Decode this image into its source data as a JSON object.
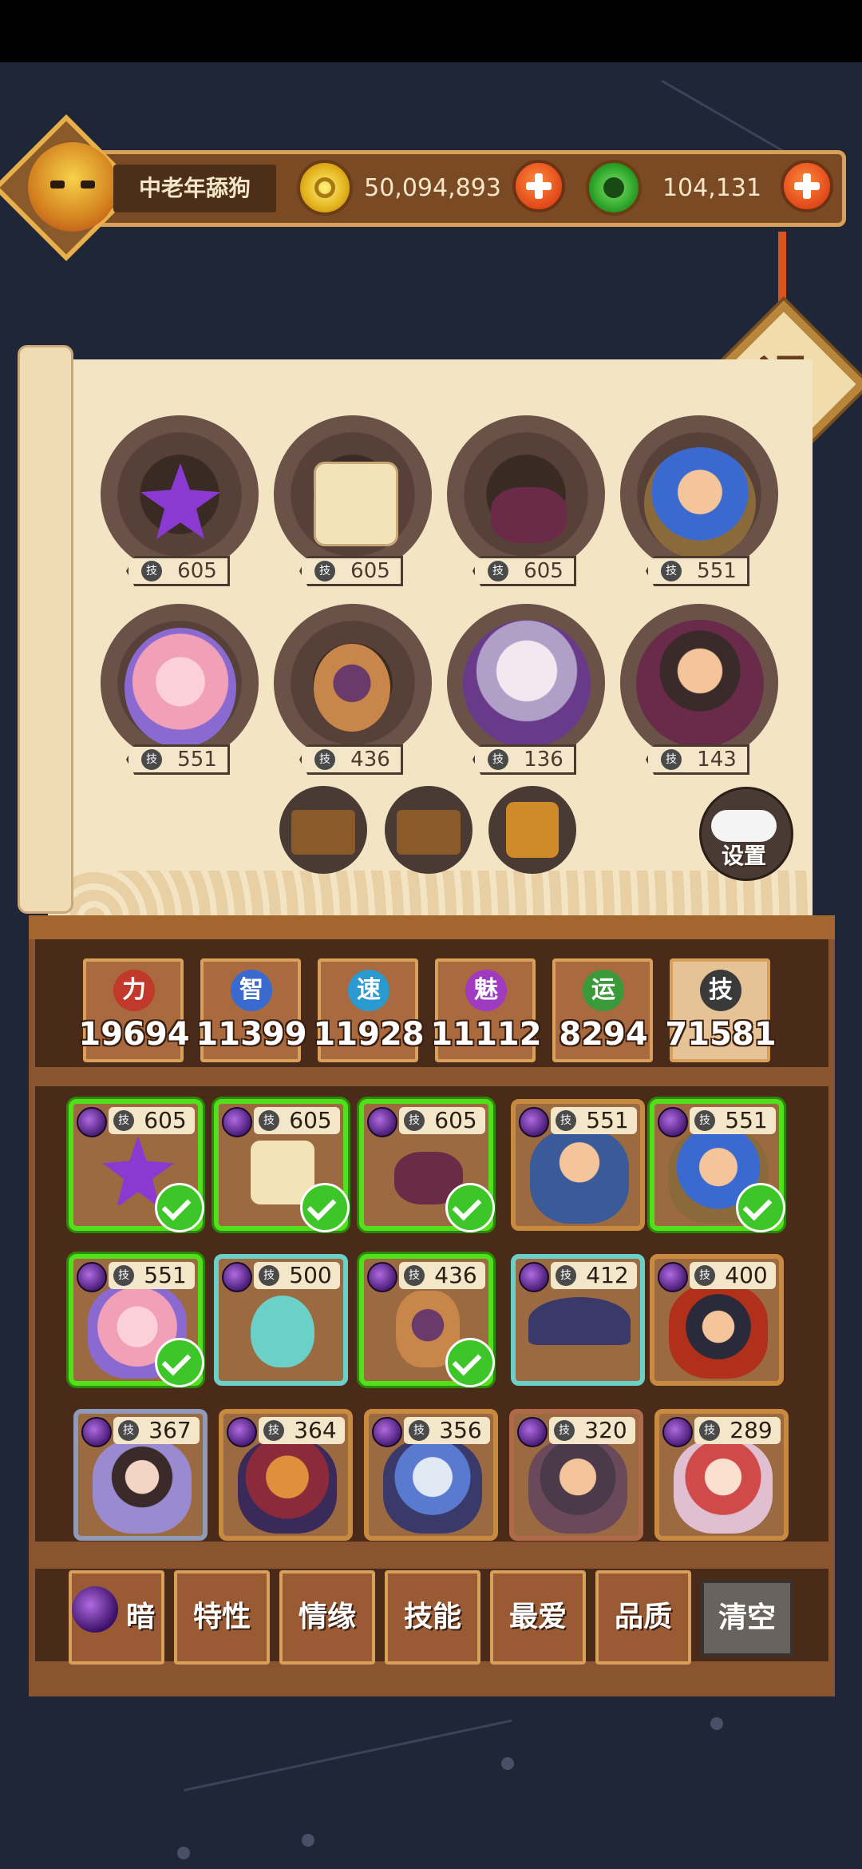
{
  "player": {
    "name": "中老年舔狗",
    "avatar_icon": "demon-mask-icon"
  },
  "currencies": {
    "gold": {
      "icon": "gold-coin-icon",
      "value": "50,094,893"
    },
    "jade": {
      "icon": "jade-coin-icon",
      "value": "104,131"
    }
  },
  "exit_label": "退",
  "team_slots": [
    {
      "name": "purple-star-hero",
      "skill": "605"
    },
    {
      "name": "tofu-hero",
      "skill": "605"
    },
    {
      "name": "pot-hero",
      "skill": "605"
    },
    {
      "name": "farmer-hero",
      "skill": "551"
    },
    {
      "name": "witch-girl-hero",
      "skill": "551"
    },
    {
      "name": "beetle-hero",
      "skill": "436"
    },
    {
      "name": "white-hair-hero",
      "skill": "136"
    },
    {
      "name": "sorcerer-hero",
      "skill": "143"
    }
  ],
  "skill_badge": "技",
  "food_items": [
    "food-box-1",
    "food-box-2",
    "mooncake-box"
  ],
  "settings_label": "设置",
  "stats": [
    {
      "label": "力",
      "value": "19694",
      "color": "#c0392b"
    },
    {
      "label": "智",
      "value": "11399",
      "color": "#3a6ad0"
    },
    {
      "label": "速",
      "value": "11928",
      "color": "#2a9ad0"
    },
    {
      "label": "魅",
      "value": "11112",
      "color": "#a03ac0"
    },
    {
      "label": "运",
      "value": "8294",
      "color": "#3a9a3a"
    },
    {
      "label": "技",
      "value": "71581",
      "color": "#3a3a3a"
    }
  ],
  "heroes": [
    {
      "name": "purple-star",
      "skill": "605",
      "selected": true
    },
    {
      "name": "tofu",
      "skill": "605",
      "selected": true
    },
    {
      "name": "pot",
      "skill": "605",
      "selected": true
    },
    {
      "name": "bearded-man",
      "skill": "551",
      "selected": false
    },
    {
      "name": "farmer",
      "skill": "551",
      "selected": true
    },
    {
      "name": "witch-girl",
      "skill": "551",
      "selected": true
    },
    {
      "name": "slime",
      "skill": "500",
      "selected": false
    },
    {
      "name": "beetle",
      "skill": "436",
      "selected": true
    },
    {
      "name": "straw-hat",
      "skill": "412",
      "selected": false
    },
    {
      "name": "general",
      "skill": "400",
      "selected": false
    },
    {
      "name": "snow-girl",
      "skill": "367",
      "selected": false
    },
    {
      "name": "pumpkin-king",
      "skill": "364",
      "selected": false
    },
    {
      "name": "ice-warrior",
      "skill": "356",
      "selected": false
    },
    {
      "name": "swordsman",
      "skill": "320",
      "selected": false
    },
    {
      "name": "flower-girl",
      "skill": "289",
      "selected": false
    }
  ],
  "filters": [
    {
      "label": "暗"
    },
    {
      "label": "特性"
    },
    {
      "label": "情缘"
    },
    {
      "label": "技能"
    },
    {
      "label": "最爱"
    },
    {
      "label": "品质"
    }
  ],
  "clear_label": "清空"
}
